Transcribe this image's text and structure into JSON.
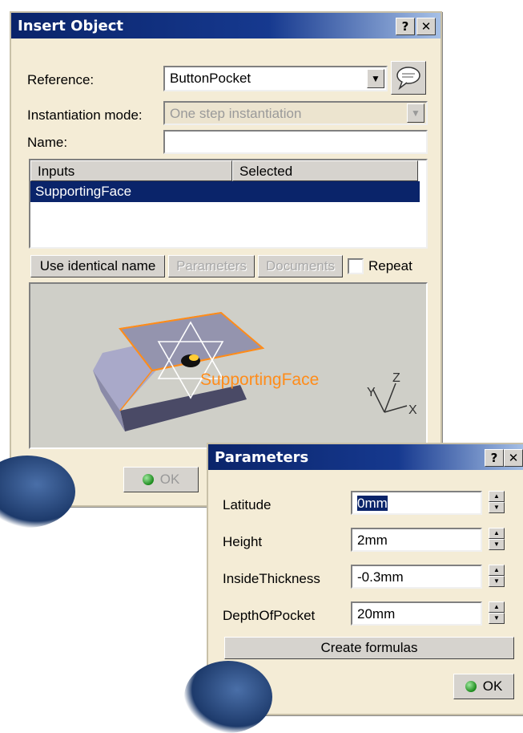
{
  "insert_object": {
    "title": "Insert Object",
    "help_button": "?",
    "close_button": "✕",
    "reference_label": "Reference:",
    "reference_value": "ButtonPocket",
    "instantiation_label": "Instantiation mode:",
    "instantiation_value": "One step instantiation",
    "name_label": "Name:",
    "name_value": "",
    "table": {
      "columns": [
        "Inputs",
        "Selected"
      ],
      "rows": [
        {
          "input": "SupportingFace",
          "selected": ""
        }
      ]
    },
    "buttons": {
      "use_identical_name": "Use identical name",
      "parameters": "Parameters",
      "documents": "Documents",
      "repeat": "Repeat",
      "ok": "OK"
    },
    "preview": {
      "face_label": "SupportingFace",
      "axis_y": "Y",
      "axis_z": "Z",
      "axis_x": "X"
    }
  },
  "parameters": {
    "title": "Parameters",
    "help_button": "?",
    "close_button": "✕",
    "fields": [
      {
        "label": "Latitude",
        "value": "0mm"
      },
      {
        "label": "Height",
        "value": "2mm"
      },
      {
        "label": "InsideThickness",
        "value": "-0.3mm"
      },
      {
        "label": "DepthOfPocket",
        "value": "20mm"
      }
    ],
    "create_formulas": "Create formulas",
    "ok": "OK"
  },
  "colors": {
    "dialog_bg": "#f4ecd6",
    "titlebar": "#0a246a",
    "selection": "#0a246a",
    "highlight": "#ff8c1a"
  }
}
